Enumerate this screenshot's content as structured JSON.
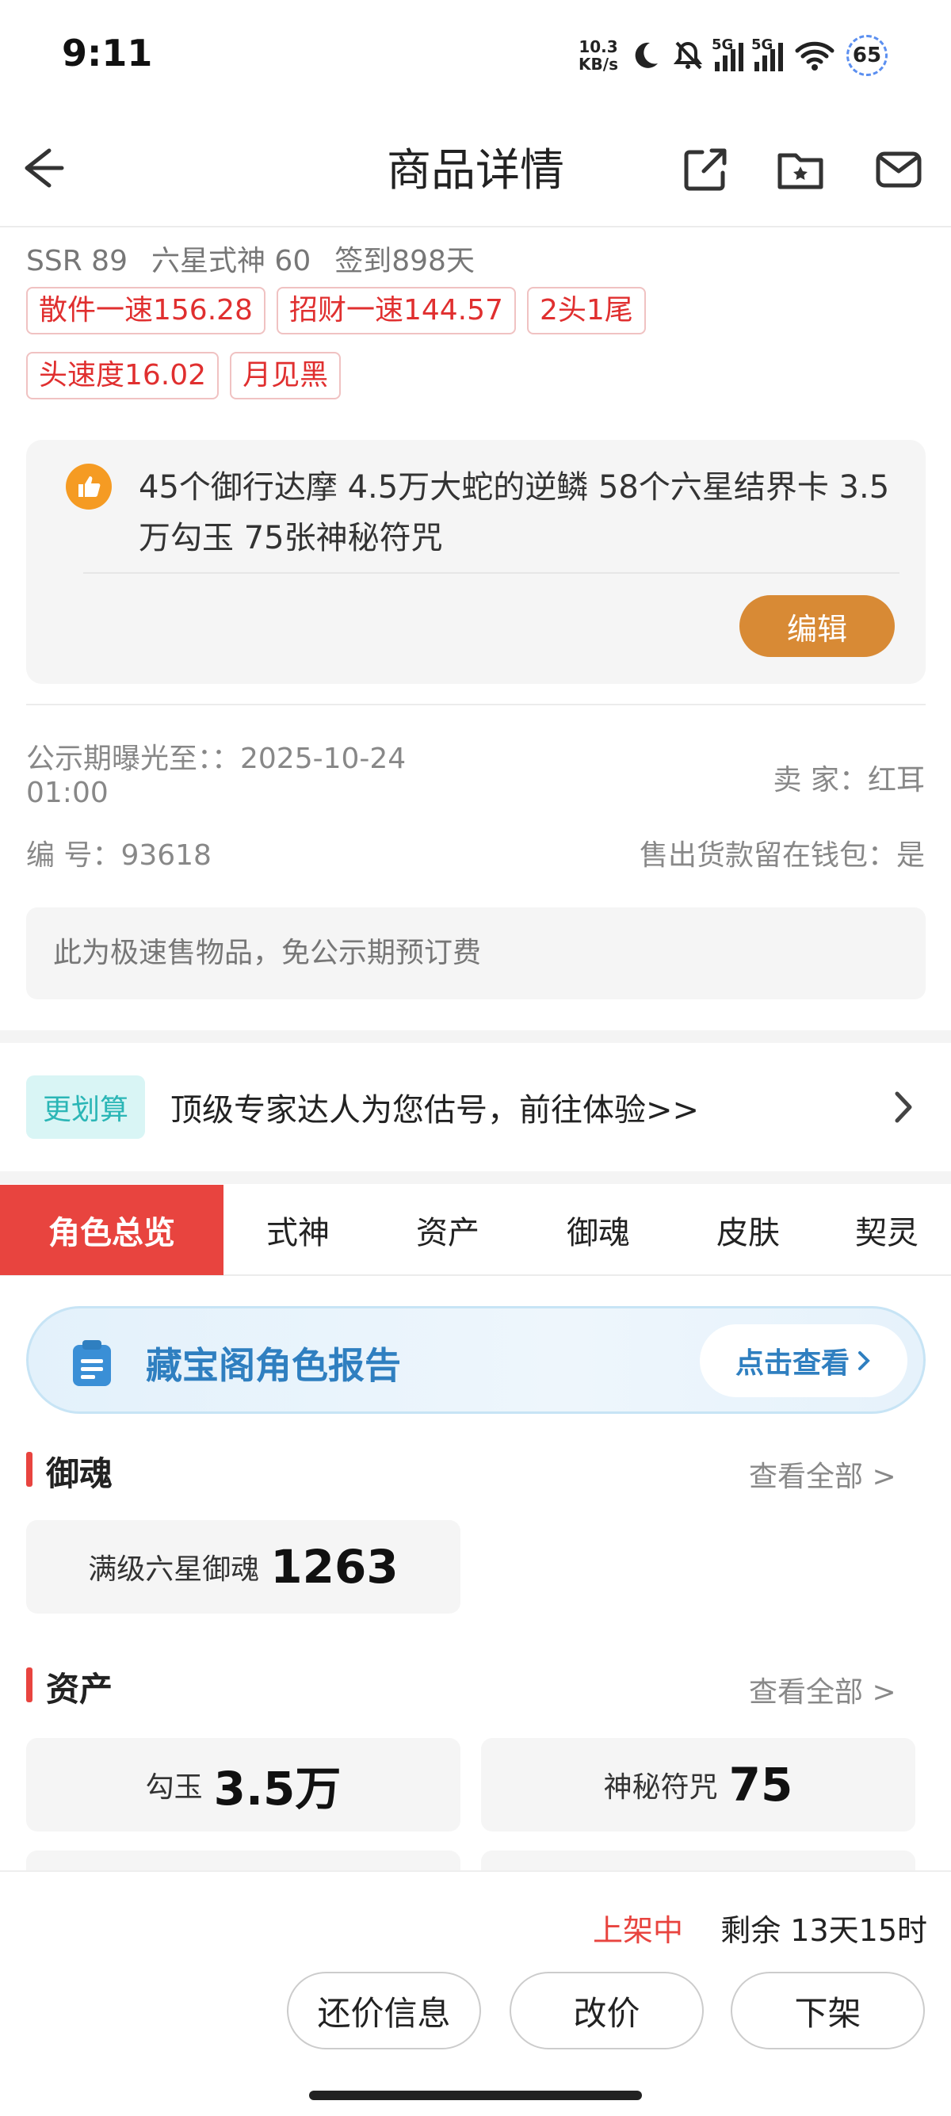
{
  "status_bar": {
    "time": "9:11",
    "net_speed_value": "10.3",
    "net_speed_unit": "KB/s",
    "signal1_label": "5G",
    "signal2_label": "5G",
    "battery": "65"
  },
  "header": {
    "title": "商品详情",
    "icons": [
      "back-arrow-icon",
      "share-icon",
      "favorite-folder-icon",
      "message-icon"
    ]
  },
  "stats": {
    "ssr": "SSR 89",
    "six_star": "六星式神 60",
    "checkin": "签到898天"
  },
  "tags": [
    "散件一速156.28",
    "招财一速144.57",
    "2头1尾",
    "头速度16.02",
    "月见黑"
  ],
  "note": {
    "text": "45个御行达摩 4.5万大蛇的逆鳞 58个六星结界卡 3.5万勾玉 75张神秘符咒",
    "edit_label": "编辑"
  },
  "info": {
    "public_label": "公示期曝光至：：2025-10-24",
    "public_time": "01:00",
    "seller": "卖 家：红耳",
    "serial": "编 号：93618",
    "wallet": "售出货款留在钱包：是",
    "notice": "此为极速售物品，免公示期预订费"
  },
  "promo": {
    "tag": "更划算",
    "text": "顶级专家达人为您估号，前往体验>>"
  },
  "tabs": [
    {
      "label": "角色总览",
      "active": true
    },
    {
      "label": "式神"
    },
    {
      "label": "资产"
    },
    {
      "label": "御魂"
    },
    {
      "label": "皮肤"
    },
    {
      "label": "契灵"
    }
  ],
  "report": {
    "title": "藏宝阁角色报告",
    "button": "点击查看"
  },
  "sections": {
    "yuhun": {
      "title": "御魂",
      "more": "查看全部 >",
      "cards": [
        {
          "label": "满级六星御魂",
          "value": "1263"
        }
      ]
    },
    "assets": {
      "title": "资产",
      "more": "查看全部 >",
      "cards": [
        {
          "label": "勾玉",
          "value": "3.5万"
        },
        {
          "label": "神秘符咒",
          "value": "75"
        }
      ]
    }
  },
  "bottom": {
    "status": "上架中",
    "remaining": "剩余 13天15时",
    "buttons": [
      "还价信息",
      "改价",
      "下架"
    ]
  },
  "colors": {
    "accent_red": "#e8443f",
    "edit_orange": "#d88a35",
    "report_blue": "#2f7fc0",
    "promo_teal": "#2bb6b6"
  }
}
